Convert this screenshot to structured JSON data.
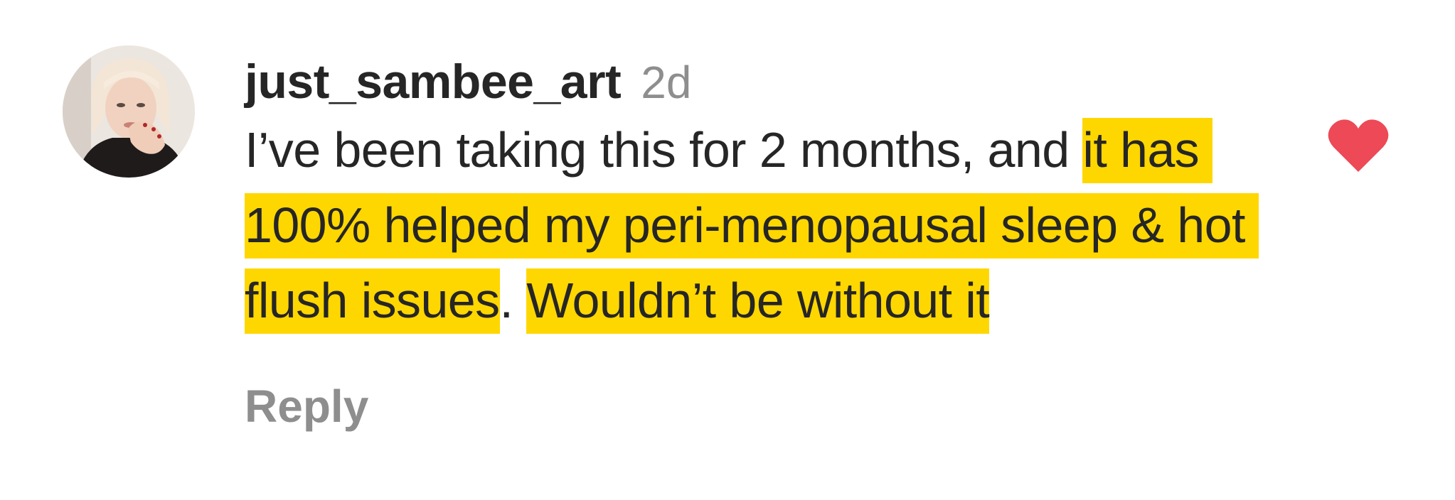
{
  "comment": {
    "username": "just_sambee_art",
    "timestamp": "2d",
    "text_segments": [
      {
        "text": "I’ve been taking this for 2 months, and ",
        "highlighted": false
      },
      {
        "text": "it has 100% helped my peri-menopausal sleep & hot flush issues",
        "highlighted": true
      },
      {
        "text": ". ",
        "highlighted": false
      },
      {
        "text": "Wouldn’t be without it",
        "highlighted": true
      }
    ],
    "reply_label": "Reply",
    "liked": true,
    "like_icon": "heart-icon",
    "avatar_icon": "avatar"
  },
  "colors": {
    "highlight": "#ffd700",
    "heart": "#ed4956",
    "text": "#262626",
    "muted": "#8e8e8e"
  }
}
